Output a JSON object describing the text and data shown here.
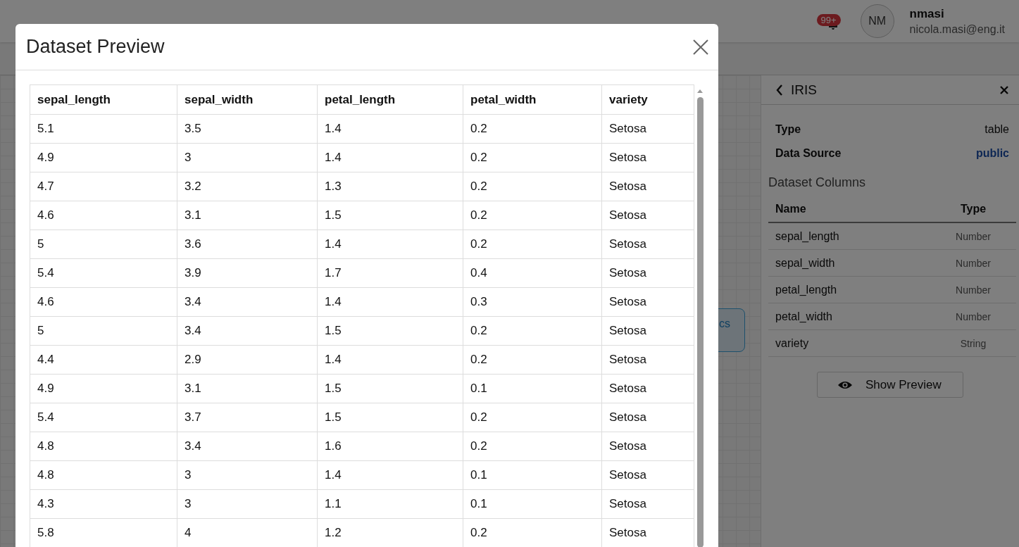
{
  "header": {
    "notification_badge": "99+",
    "avatar_initials": "NM",
    "username": "nmasi",
    "email": "nicola.masi@eng.it"
  },
  "canvas": {
    "node_label": "cs"
  },
  "side_panel": {
    "title": "IRIS",
    "properties": [
      {
        "label": "Type",
        "value": "table",
        "kind": "text"
      },
      {
        "label": "Data Source",
        "value": "public",
        "kind": "link"
      }
    ],
    "columns_title": "Dataset Columns",
    "columns_headers": [
      "Name",
      "Type"
    ],
    "columns": [
      {
        "name": "sepal_length",
        "type": "Number"
      },
      {
        "name": "sepal_width",
        "type": "Number"
      },
      {
        "name": "petal_length",
        "type": "Number"
      },
      {
        "name": "petal_width",
        "type": "Number"
      },
      {
        "name": "variety",
        "type": "String"
      }
    ],
    "button": "Show Preview"
  },
  "modal": {
    "title": "Dataset Preview",
    "table": {
      "columns": [
        "sepal_length",
        "sepal_width",
        "petal_length",
        "petal_width",
        "variety"
      ],
      "rows": [
        [
          "5.1",
          "3.5",
          "1.4",
          "0.2",
          "Setosa"
        ],
        [
          "4.9",
          "3",
          "1.4",
          "0.2",
          "Setosa"
        ],
        [
          "4.7",
          "3.2",
          "1.3",
          "0.2",
          "Setosa"
        ],
        [
          "4.6",
          "3.1",
          "1.5",
          "0.2",
          "Setosa"
        ],
        [
          "5",
          "3.6",
          "1.4",
          "0.2",
          "Setosa"
        ],
        [
          "5.4",
          "3.9",
          "1.7",
          "0.4",
          "Setosa"
        ],
        [
          "4.6",
          "3.4",
          "1.4",
          "0.3",
          "Setosa"
        ],
        [
          "5",
          "3.4",
          "1.5",
          "0.2",
          "Setosa"
        ],
        [
          "4.4",
          "2.9",
          "1.4",
          "0.2",
          "Setosa"
        ],
        [
          "4.9",
          "3.1",
          "1.5",
          "0.1",
          "Setosa"
        ],
        [
          "5.4",
          "3.7",
          "1.5",
          "0.2",
          "Setosa"
        ],
        [
          "4.8",
          "3.4",
          "1.6",
          "0.2",
          "Setosa"
        ],
        [
          "4.8",
          "3",
          "1.4",
          "0.1",
          "Setosa"
        ],
        [
          "4.3",
          "3",
          "1.1",
          "0.1",
          "Setosa"
        ],
        [
          "5.8",
          "4",
          "1.2",
          "0.2",
          "Setosa"
        ]
      ]
    }
  }
}
